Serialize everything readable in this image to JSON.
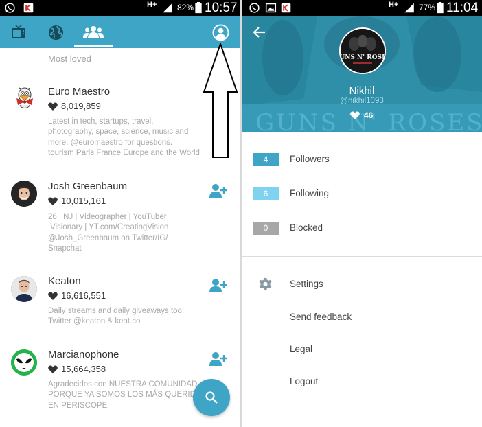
{
  "left_screen": {
    "status_bar": {
      "battery_percent": "82%",
      "time": "10:57",
      "network": "H+"
    },
    "tabs": [
      {
        "name": "tv",
        "icon": "tv-icon"
      },
      {
        "name": "global",
        "icon": "globe-icon"
      },
      {
        "name": "people",
        "icon": "people-icon",
        "active": true
      },
      {
        "name": "profile",
        "icon": "profile-icon"
      }
    ],
    "section_title": "Most loved",
    "users": [
      {
        "name": "Euro Maestro",
        "loves": "8,019,859",
        "bio": [
          "Latest in tech, startups, travel,",
          "photography, space, science, music and",
          "more.  @euromaestro for questions.",
          "tourism Paris France Europe and the World"
        ],
        "show_follow": false
      },
      {
        "name": "Josh Greenbaum",
        "loves": "10,015,161",
        "bio": [
          "26 | NJ | Videographer | YouTuber",
          "|Visionary | YT.com/CreatingVision",
          "@Josh_Greenbaum on Twitter/IG/",
          "Snapchat"
        ],
        "show_follow": true
      },
      {
        "name": "Keaton",
        "loves": "16,616,551",
        "bio": [
          "Daily streams and daily giveaways too!",
          "Twitter @keaton & keat.co"
        ],
        "show_follow": true
      },
      {
        "name": "Marcianophone",
        "loves": "15,664,358",
        "bio": [
          "Agradecidos con NUESTRA COMUNIDAD",
          "PORQUE YA SOMOS LOS MÁS QUERIDOS",
          "EN PERISCOPE"
        ],
        "show_follow": true
      }
    ],
    "colors": {
      "accent": "#3ea5c6",
      "bio_text": "#a9a9a9"
    }
  },
  "right_screen": {
    "status_bar": {
      "battery_percent": "77%",
      "time": "11:04",
      "network": "H+"
    },
    "profile": {
      "avatar_text": "GUNS N' ROSES",
      "name": "Nikhil",
      "handle": "@nikhil1093",
      "loves": "46",
      "background_text": "GUNS N' ROSES"
    },
    "stats": [
      {
        "count": "4",
        "label": "Followers",
        "color": "#3ea5c6"
      },
      {
        "count": "6",
        "label": "Following",
        "color": "#7fd3ee"
      },
      {
        "count": "0",
        "label": "Blocked",
        "color": "#a7a7a7"
      }
    ],
    "menu": [
      {
        "label": "Settings",
        "icon": "gear-icon"
      },
      {
        "label": "Send feedback"
      },
      {
        "label": "Legal"
      },
      {
        "label": "Logout"
      }
    ]
  }
}
